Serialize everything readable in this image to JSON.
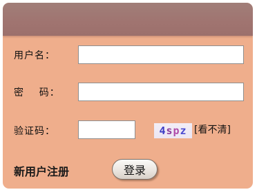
{
  "form": {
    "username": {
      "label": "用户名：",
      "value": ""
    },
    "password": {
      "label": "密    码：",
      "value": ""
    },
    "captcha": {
      "label": "验证码：",
      "value": "",
      "image_text": [
        "4",
        "s",
        "p",
        "z"
      ],
      "refresh_label": "[看不清]"
    },
    "register_label": "新用户注册",
    "login_label": "登录"
  },
  "colors": {
    "panel": "#efae8c",
    "header": "#a07470"
  }
}
